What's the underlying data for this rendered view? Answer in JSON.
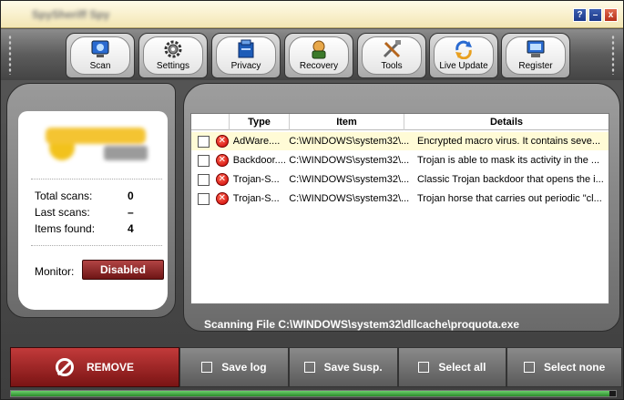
{
  "window": {
    "title": "SpySheriff Spy",
    "controls": {
      "help": "?",
      "minimize": "–",
      "close": "x"
    }
  },
  "toolbar": {
    "tabs": [
      {
        "label": "Scan",
        "icon": "scan-icon"
      },
      {
        "label": "Settings",
        "icon": "gear-icon"
      },
      {
        "label": "Privacy",
        "icon": "privacy-icon"
      },
      {
        "label": "Recovery",
        "icon": "recovery-icon"
      },
      {
        "label": "Tools",
        "icon": "tools-icon"
      },
      {
        "label": "Live Update",
        "icon": "update-icon"
      },
      {
        "label": "Register",
        "icon": "register-icon"
      }
    ]
  },
  "stats": {
    "total_scans_label": "Total scans:",
    "total_scans_value": "0",
    "last_scans_label": "Last scans:",
    "last_scans_value": "–",
    "items_found_label": "Items found:",
    "items_found_value": "4",
    "monitor_label": "Monitor:",
    "monitor_value": "Disabled"
  },
  "results": {
    "columns": [
      "Type",
      "Item",
      "Details"
    ],
    "rows": [
      {
        "type": "AdWare....",
        "item": "C:\\WINDOWS\\system32\\...",
        "details": "Encrypted macro virus. It contains seve..."
      },
      {
        "type": "Backdoor....",
        "item": "C:\\WINDOWS\\system32\\...",
        "details": "Trojan is able to mask its activity in the ..."
      },
      {
        "type": "Trojan-S...",
        "item": "C:\\WINDOWS\\system32\\...",
        "details": "Classic Trojan backdoor that opens the i..."
      },
      {
        "type": "Trojan-S...",
        "item": "C:\\WINDOWS\\system32\\...",
        "details": "Trojan horse that carries out periodic \"cl..."
      }
    ]
  },
  "scan_status": "Scanning File C:\\WINDOWS\\system32\\dllcache\\proquota.exe",
  "actions": {
    "remove": "REMOVE",
    "save_log": "Save log",
    "save_susp": "Save Susp.",
    "select_all": "Select all",
    "select_none": "Select none"
  },
  "progress": {
    "fraction": 0.99
  },
  "colors": {
    "accent_red": "#8b1a1a",
    "title_bar": "#f6ecc4",
    "selected_row": "#fffbd6",
    "progress_green": "#4caf50"
  }
}
